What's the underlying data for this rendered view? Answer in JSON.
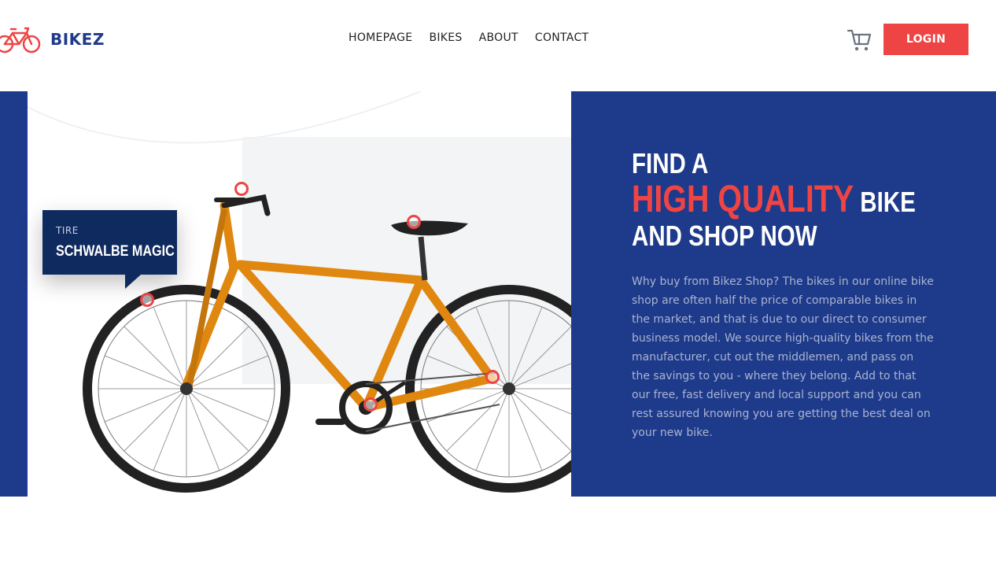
{
  "brand": {
    "name": "BIKEZ",
    "accent_color": "#ef4444",
    "primary_color": "#1e3a8a"
  },
  "nav": {
    "items": [
      {
        "label": "HOMEPAGE"
      },
      {
        "label": "BIKES"
      },
      {
        "label": "ABOUT"
      },
      {
        "label": "CONTACT"
      }
    ]
  },
  "header": {
    "cart_icon": "cart-icon",
    "login_label": "LOGIN"
  },
  "hero": {
    "headline_line1": "FIND A",
    "headline_accent": "HIGH QUALITY",
    "headline_line2_rest": " BIKE",
    "headline_line3": "AND SHOP NOW",
    "description": "Why buy from Bikez Shop? The bikes in our online bike shop are often half the price of comparable bikes in the market, and that is due to our direct to consumer business model. We source high-quality bikes from the manufacturer, cut out the middlemen, and pass on the savings to you - where they belong. Add to that our free, fast delivery and local support and you can rest assured knowing you are getting the best deal on your new bike.",
    "tooltip": {
      "label": "TIRE",
      "value": "SCHWALBE MAGIC"
    }
  }
}
